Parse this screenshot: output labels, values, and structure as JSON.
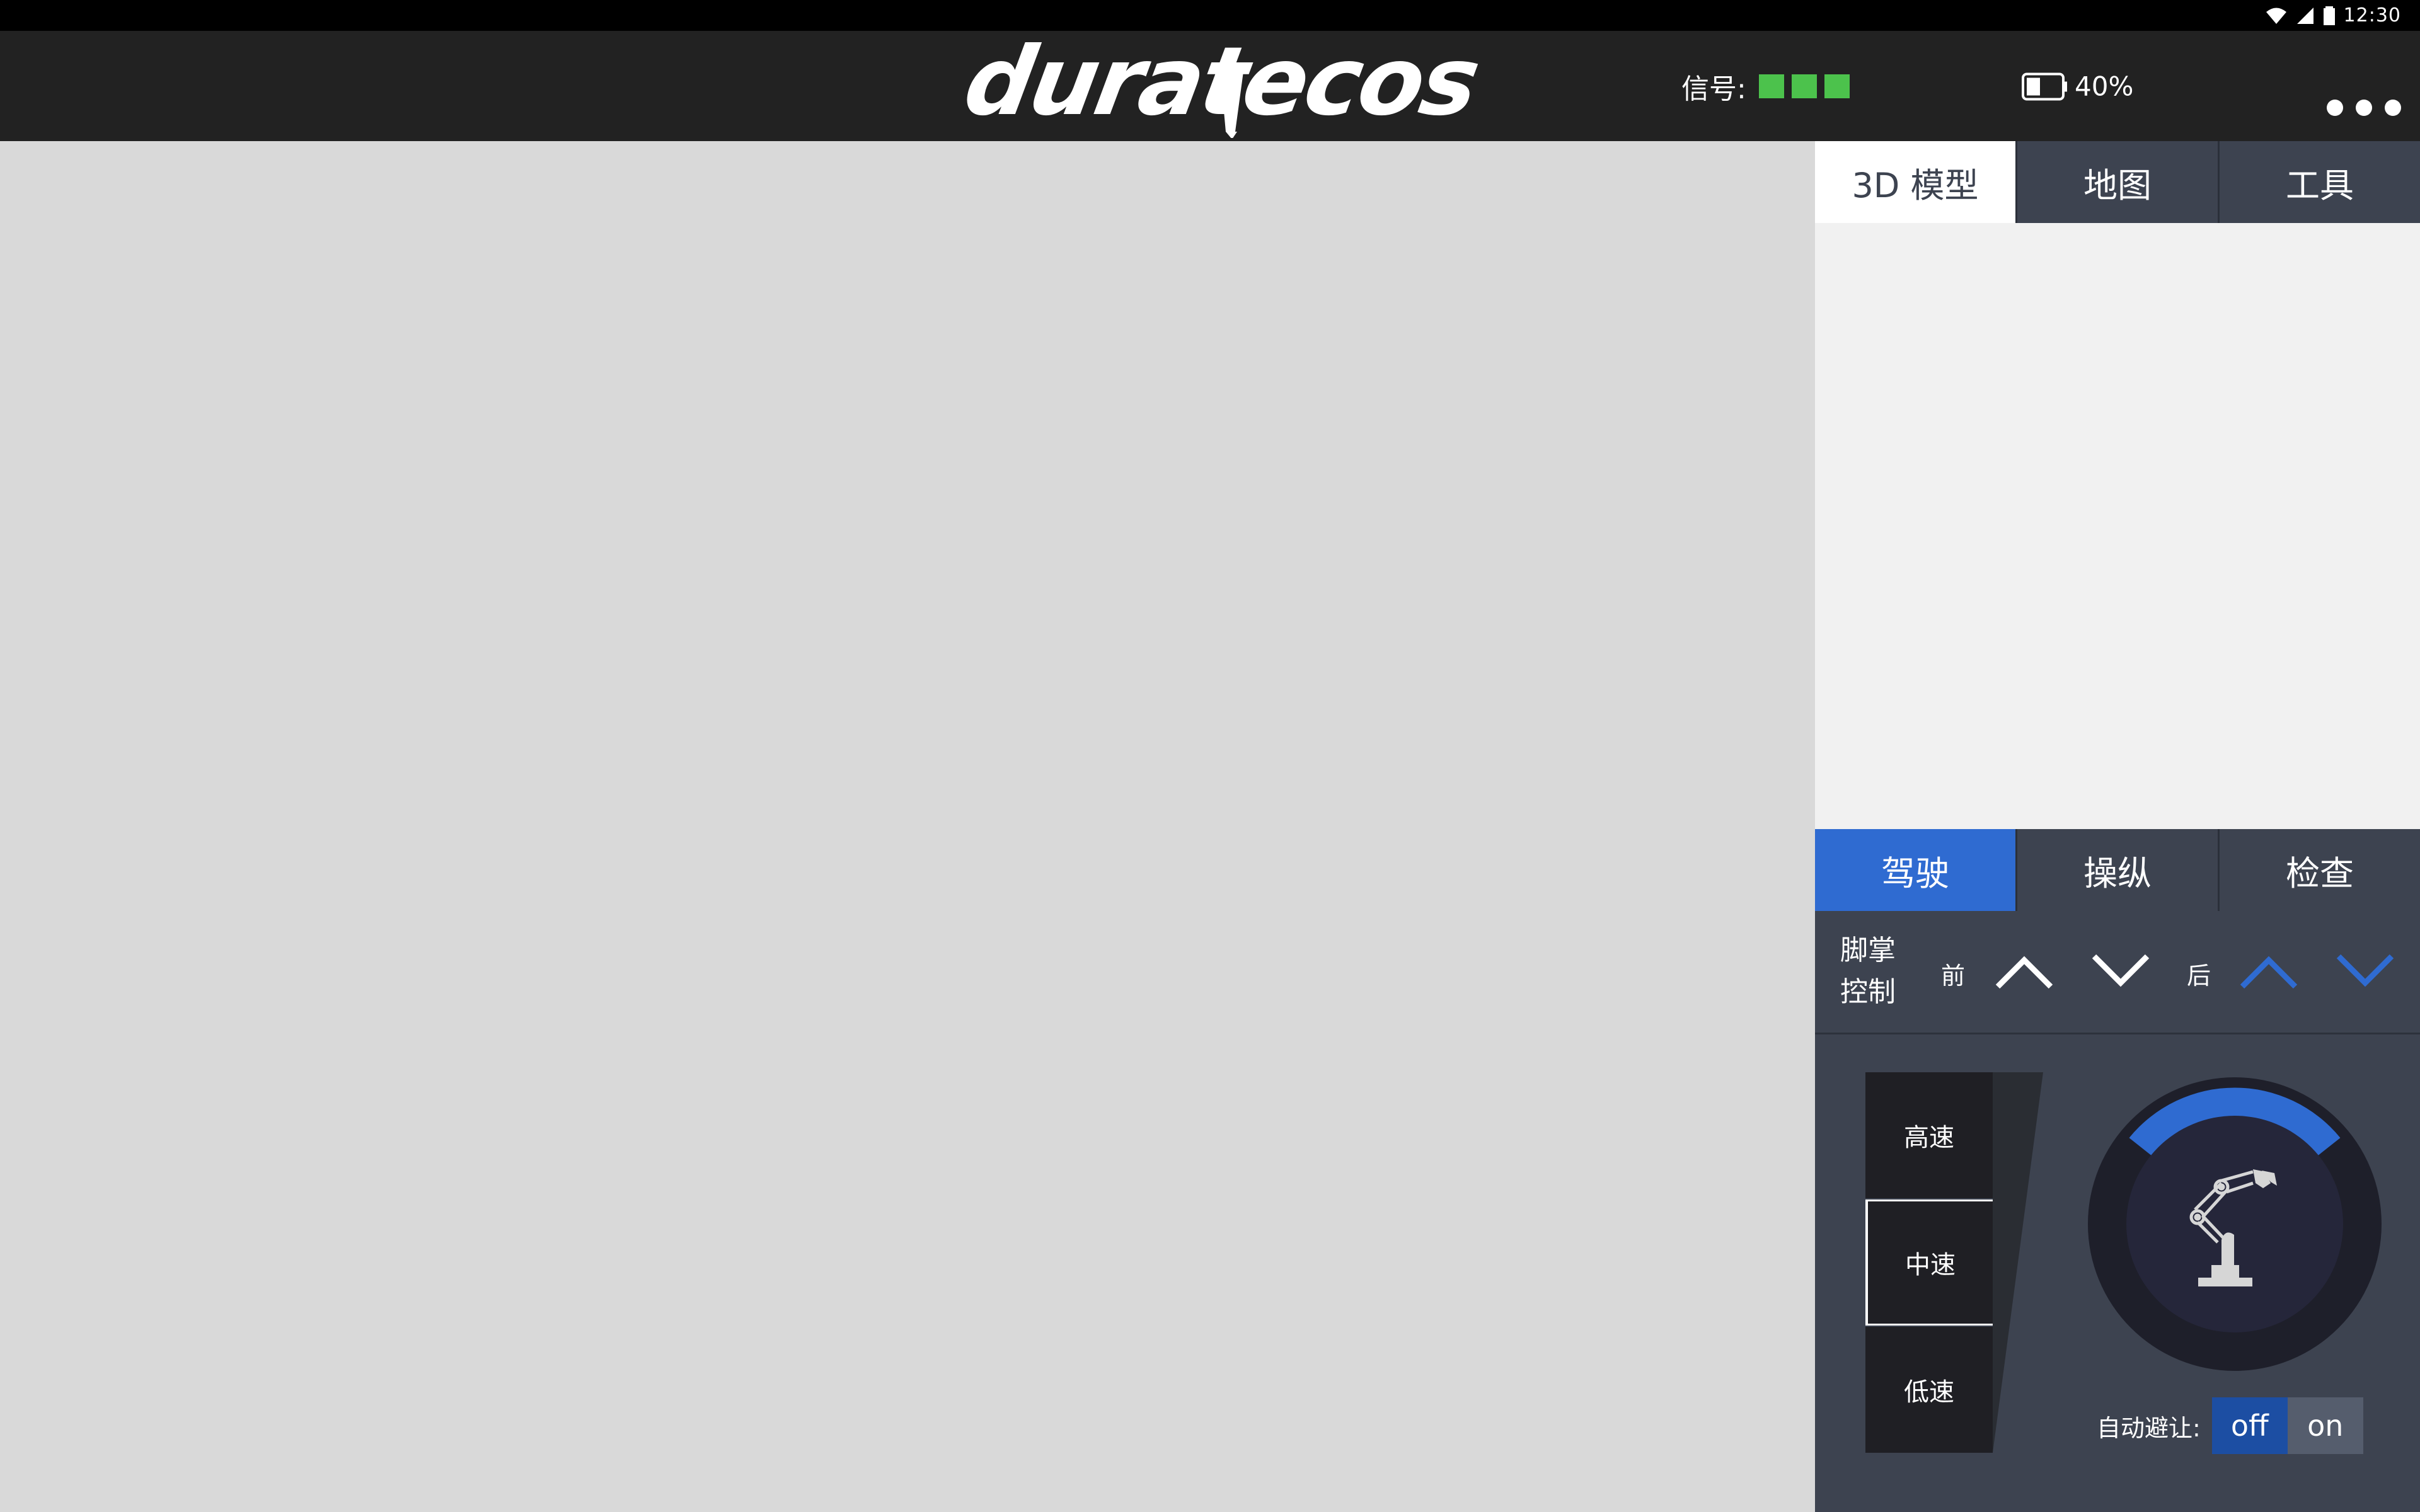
{
  "status_bar": {
    "time": "12:30"
  },
  "header": {
    "logo_text": "duratecos",
    "signal_label": "信号:",
    "signal_bars": 3,
    "battery_percent": "40%",
    "battery_level": 0.4
  },
  "view_tabs": [
    {
      "label": "3D 模型",
      "active": true
    },
    {
      "label": "地图",
      "active": false
    },
    {
      "label": "工具",
      "active": false
    }
  ],
  "mode_tabs": [
    {
      "label": "驾驶",
      "active": true
    },
    {
      "label": "操纵",
      "active": false
    },
    {
      "label": "检查",
      "active": false
    }
  ],
  "foot_control": {
    "title_line1": "脚掌",
    "title_line2": "控制",
    "front_label": "前",
    "back_label": "后"
  },
  "speeds": [
    {
      "label": "高速",
      "selected": false
    },
    {
      "label": "中速",
      "selected": true
    },
    {
      "label": "低速",
      "selected": false
    }
  ],
  "auto_avoid": {
    "label": "自动避让:",
    "off_label": "off",
    "on_label": "on",
    "value": "off"
  },
  "colors": {
    "accent": "#2f6bd1",
    "signal_green": "#4cc24c",
    "panel_bg": "#3d4350",
    "header_bg": "#222222"
  }
}
